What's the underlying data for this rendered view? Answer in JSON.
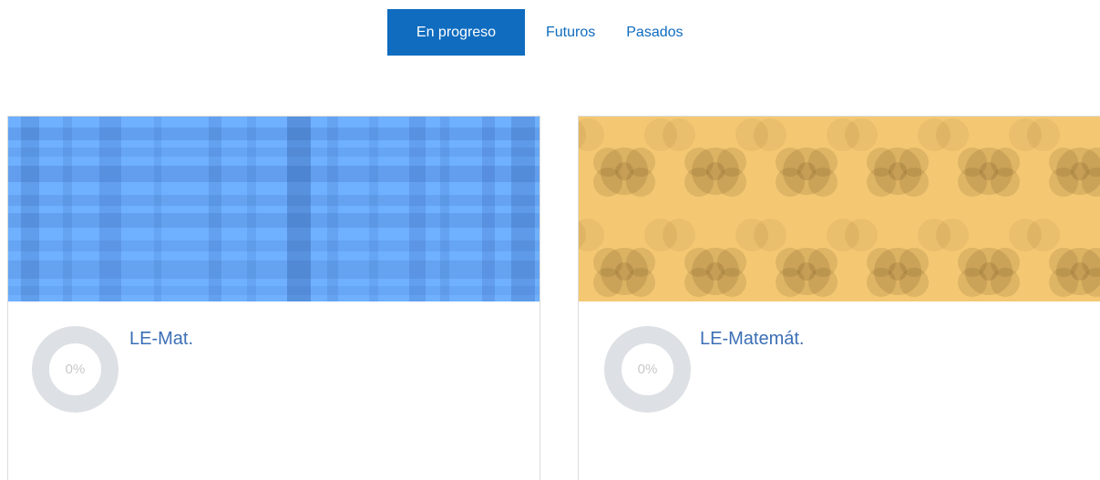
{
  "tabs": [
    {
      "label": "En progreso",
      "active": true
    },
    {
      "label": "Futuros",
      "active": false
    },
    {
      "label": "Pasados",
      "active": false
    }
  ],
  "courses": [
    {
      "name": "LE-Mat.",
      "progress_percent": 0,
      "progress_label": "0%",
      "banner_color": "#6fb0ff",
      "pattern": "plaid"
    },
    {
      "name": "LE-Matemát.",
      "progress_percent": 0,
      "progress_label": "0%",
      "banner_color": "#f4c873",
      "pattern": "circles"
    }
  ],
  "colors": {
    "accent": "#0f6cbf",
    "link": "#3b6fb6",
    "progress_ring": "#dde0e4"
  }
}
